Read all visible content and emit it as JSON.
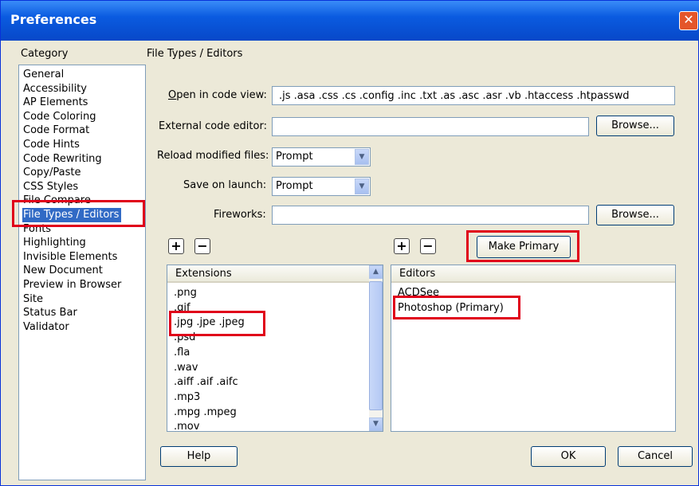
{
  "window": {
    "title": "Preferences",
    "close_glyph": "✕"
  },
  "category": {
    "label": "Category",
    "items": [
      "General",
      "Accessibility",
      "AP Elements",
      "Code Coloring",
      "Code Format",
      "Code Hints",
      "Code Rewriting",
      "Copy/Paste",
      "CSS Styles",
      "File Compare",
      "File Types / Editors",
      "Fonts",
      "Highlighting",
      "Invisible Elements",
      "New Document",
      "Preview in Browser",
      "Site",
      "Status Bar",
      "Validator"
    ],
    "selected": "File Types / Editors"
  },
  "panel": {
    "title": "File Types / Editors",
    "open_in_code_view_label": "Open in code view:",
    "open_in_code_view_value": ".js .asa .css .cs .config .inc .txt .as .asc .asr .vb .htaccess .htpasswd",
    "external_editor_label": "External code editor:",
    "external_editor_value": "",
    "browse_label": "Browse...",
    "reload_label": "Reload modified files:",
    "reload_value": "Prompt",
    "save_label": "Save on launch:",
    "save_value": "Prompt",
    "fireworks_label": "Fireworks:",
    "fireworks_value": "",
    "plus_glyph": "+",
    "minus_glyph": "−",
    "make_primary_label": "Make Primary"
  },
  "extensions": {
    "header": "Extensions",
    "items": [
      ".png",
      ".gif",
      ".jpg .jpe .jpeg",
      ".psd",
      ".fla",
      ".wav",
      ".aiff .aif .aifc",
      ".mp3",
      ".mpg .mpeg",
      ".mov"
    ]
  },
  "editors": {
    "header": "Editors",
    "items": [
      "ACDSee",
      "Photoshop (Primary)"
    ]
  },
  "footer": {
    "help_label": "Help",
    "ok_label": "OK",
    "cancel_label": "Cancel"
  },
  "colors": {
    "highlight": "#e0001a",
    "selection": "#316ac5",
    "titlebar": "#0a5be0"
  }
}
